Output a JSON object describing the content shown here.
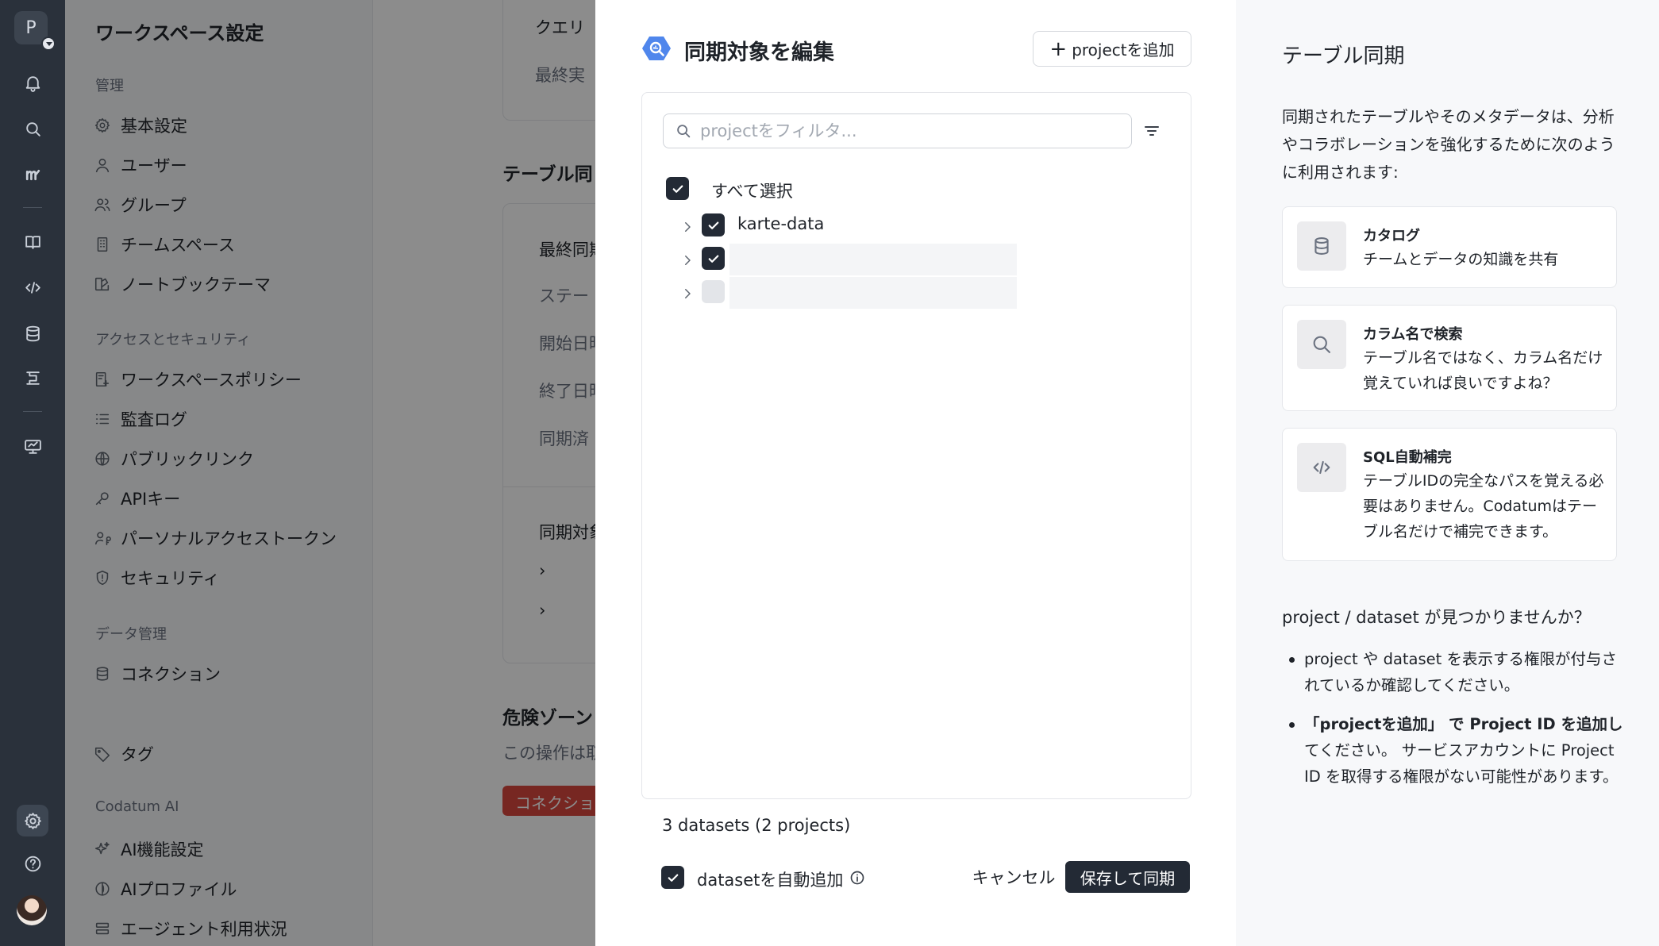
{
  "rail": {
    "workspace_initial": "P",
    "icons": [
      "bell-icon",
      "search-icon",
      "logo-icon",
      "book-icon",
      "code-icon",
      "database-icon",
      "pipeline-icon",
      "monitor-icon",
      "gear-icon",
      "help-icon"
    ]
  },
  "settings": {
    "title": "ワークスペース設定",
    "sections": {
      "admin": "管理",
      "access": "アクセスとセキュリティ",
      "data": "データ管理",
      "ai": "Codatum AI"
    },
    "items": {
      "basic": "基本設定",
      "users": "ユーザー",
      "groups": "グループ",
      "teamspaces": "チームスペース",
      "notebook_theme": "ノートブックテーマ",
      "workspace_policy": "ワークスペースポリシー",
      "audit_log": "監査ログ",
      "public_links": "パブリックリンク",
      "api_keys": "APIキー",
      "personal_tokens": "パーソナルアクセストークン",
      "security": "セキュリティ",
      "connections": "コネクション",
      "tags": "タグ",
      "ai_settings": "AI機能設定",
      "ai_profile": "AIプロファイル",
      "agent_usage": "エージェント利用状況"
    }
  },
  "background": {
    "query_label": "クエリ",
    "last_run_label": "最終実",
    "table_sync_heading": "テーブル同",
    "last_sync_label": "最終同期",
    "status_label": "ステー",
    "start_label": "開始日時",
    "end_label": "終了日時",
    "synced_label": "同期済",
    "targets_label": "同期対象",
    "danger_heading": "危険ゾーン",
    "danger_desc": "この操作は取",
    "danger_button": "コネクショ"
  },
  "modal": {
    "title": "同期対象を編集",
    "add_project": "projectを追加",
    "filter_placeholder": "projectをフィルタ...",
    "select_all": "すべて選択",
    "projects": [
      {
        "name": "karte-data",
        "checked": true
      },
      {
        "name": "",
        "checked": true
      },
      {
        "name": "",
        "checked": false
      }
    ],
    "summary": "3 datasets (2 projects)",
    "auto_add_label": "datasetを自動追加",
    "auto_add_checked": true,
    "cancel": "キャンセル",
    "save_sync": "保存して同期"
  },
  "help": {
    "title": "テーブル同期",
    "intro": "同期されたテーブルやそのメタデータは、分析やコラボレーションを強化するために次のように利用されます:",
    "features": [
      {
        "icon": "database-icon",
        "title": "カタログ",
        "desc": "チームとデータの知識を共有"
      },
      {
        "icon": "search-icon",
        "title": "カラム名で検索",
        "desc": "テーブル名ではなく、カラム名だけ覚えていれば良いですよね？"
      },
      {
        "icon": "code-icon",
        "title": "SQL自動補完",
        "desc": "テーブルIDの完全なパスを覚える必要はありません。Codatumはテーブル名だけで補完できます。"
      }
    ],
    "question": "project / dataset が見つかりませんか？",
    "bullet1": "project や dataset を表示する権限が付与されているか確認してください。",
    "bullet2_prefix": "「projectを追加」 で Project ID を追加し",
    "bullet2_rest": "てください。 サービスアカウントに Project ID を取得する権限がない可能性があります。"
  },
  "colors": {
    "rail_bg": "#2a313b",
    "primary_dark": "#232a35",
    "danger": "#d9473f",
    "bigquery_blue": "#4f86ec"
  }
}
